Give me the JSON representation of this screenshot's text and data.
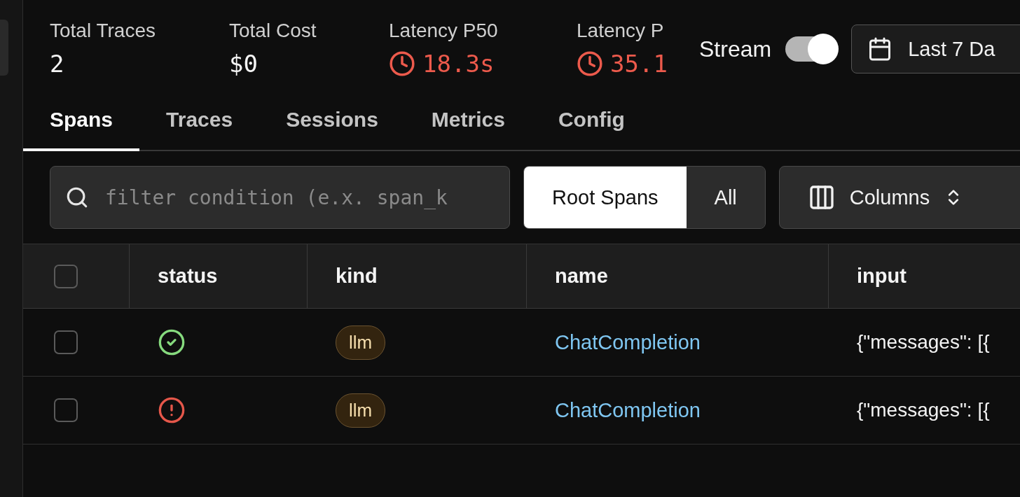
{
  "stats": [
    {
      "label": "Total Traces",
      "value": "2",
      "kind": "plain"
    },
    {
      "label": "Total Cost",
      "value": "$0",
      "kind": "plain"
    },
    {
      "label": "Latency P50",
      "value": "18.3s",
      "kind": "latency"
    },
    {
      "label": "Latency P",
      "value": "35.1",
      "kind": "latency"
    }
  ],
  "stream": {
    "label": "Stream",
    "on": true
  },
  "date_range": {
    "label": "Last 7 Da"
  },
  "tabs": [
    {
      "label": "Spans",
      "selected": true
    },
    {
      "label": "Traces",
      "selected": false
    },
    {
      "label": "Sessions",
      "selected": false
    },
    {
      "label": "Metrics",
      "selected": false
    },
    {
      "label": "Config",
      "selected": false
    }
  ],
  "filter": {
    "placeholder": "filter condition (e.x. span_k"
  },
  "span_filter": [
    {
      "label": "Root Spans",
      "selected": true
    },
    {
      "label": "All",
      "selected": false
    }
  ],
  "columns_button": {
    "label": "Columns"
  },
  "table": {
    "select_all": {
      "checked": false
    },
    "columns": [
      "status",
      "kind",
      "name",
      "input"
    ],
    "rows": [
      {
        "checked": false,
        "failed": false,
        "kind": "llm",
        "name": "ChatCompletion",
        "input": "{\"messages\": [{"
      },
      {
        "checked": false,
        "failed": true,
        "kind": "llm",
        "name": "ChatCompletion",
        "input": "{\"messages\": [{"
      }
    ]
  }
}
